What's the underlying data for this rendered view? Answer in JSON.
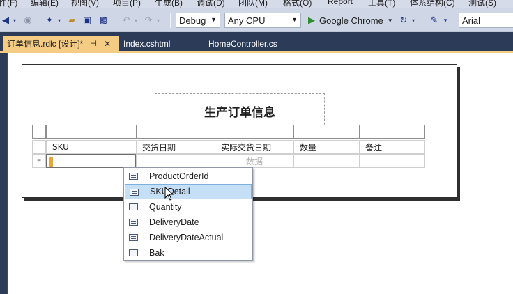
{
  "menu": [
    "件(F)",
    "编辑(E)",
    "视图(V)",
    "项目(P)",
    "生成(B)",
    "调试(D)",
    "团队(M)",
    "格式(O)",
    "Report",
    "工具(T)",
    "体系结构(C)",
    "测试(S)"
  ],
  "toolbar": {
    "config": "Debug",
    "platform": "Any CPU",
    "run_target": "Google Chrome",
    "font": "Arial"
  },
  "tabs": {
    "active": "订单信息.rdlc [设计]*",
    "pin_glyph": "⊣",
    "close_glyph": "✕",
    "second": "Index.cshtml",
    "third": "HomeController.cs"
  },
  "report": {
    "title": "生产订单信息",
    "columns": [
      "SKU",
      "交货日期",
      "实际交货日期",
      "数量",
      "备注"
    ],
    "row_handle": "≡",
    "placeholder": "数据"
  },
  "field_list": {
    "items": [
      "ProductOrderId",
      "SKUDetail",
      "Quantity",
      "DeliveryDate",
      "DeliveryDateActual",
      "Bak"
    ],
    "selected_index": 1
  },
  "colors": {
    "accent_tab": "#f5cc84",
    "chrome": "#2b3b58",
    "selection": "#c5dff6"
  }
}
